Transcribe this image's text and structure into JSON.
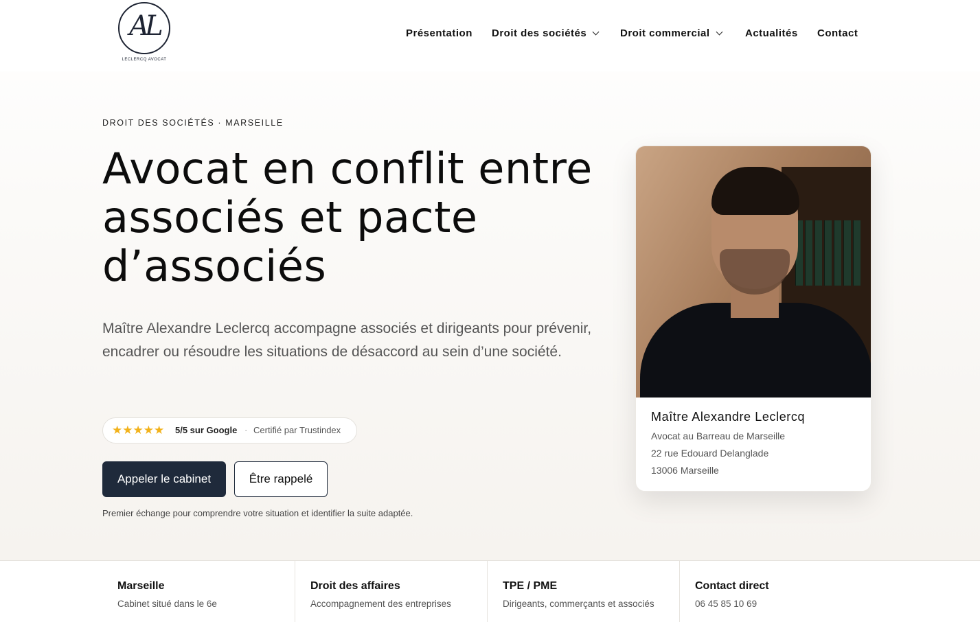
{
  "brand": {
    "monogram": "AL",
    "name": "LECLERCQ AVOCAT"
  },
  "nav": {
    "items": [
      {
        "label": "Présentation",
        "has_dropdown": false
      },
      {
        "label": "Droit des sociétés",
        "has_dropdown": true
      },
      {
        "label": "Droit commercial",
        "has_dropdown": true
      },
      {
        "label": "Actualités",
        "has_dropdown": false
      },
      {
        "label": "Contact",
        "has_dropdown": false
      }
    ]
  },
  "hero": {
    "eyebrow": "DROIT DES SOCIÉTÉS · MARSEILLE",
    "title": "Avocat en conflit entre associés et pacte d’associés",
    "lead": "Maître Alexandre Leclercq accompagne associés et dirigeants pour prévenir, encadrer ou résoudre les situations de désaccord au sein d’une société.",
    "rating": {
      "stars": "★★★★★",
      "score": "5/5 sur Google",
      "separator": "·",
      "certified": "Certifié par Trustindex",
      "star_color": "#f2b21b"
    },
    "primary_button": "Appeler le cabinet",
    "secondary_button": "Être rappelé",
    "note": "Premier échange pour comprendre votre situation et identifier la suite adaptée."
  },
  "profile": {
    "name": "Maître Alexandre Leclercq",
    "role": "Avocat au Barreau de Marseille",
    "address_line1": "22 rue Edouard Delanglade",
    "address_line2": "13006 Marseille"
  },
  "features": [
    {
      "title": "Marseille",
      "subtitle": "Cabinet situé dans le 6e"
    },
    {
      "title": "Droit des affaires",
      "subtitle": "Accompagnement des entreprises"
    },
    {
      "title": "TPE / PME",
      "subtitle": "Dirigeants, commerçants et associés"
    },
    {
      "title": "Contact direct",
      "subtitle": "06 45 85 10 69"
    }
  ],
  "colors": {
    "primary": "#1f2a3b",
    "star": "#f2b21b",
    "text_muted": "#555555"
  }
}
